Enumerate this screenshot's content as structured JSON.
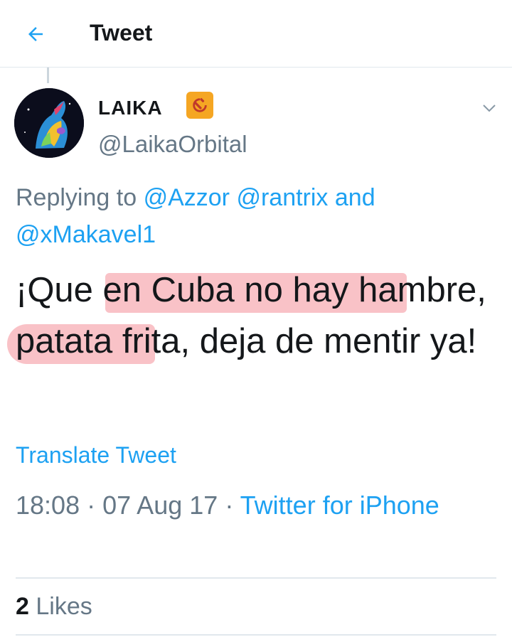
{
  "header": {
    "title": "Tweet"
  },
  "author": {
    "name": "LAIKA",
    "badge_emoji": "☭",
    "handle": "@LaikaOrbital"
  },
  "reply": {
    "prefix": "Replying to",
    "mention_1": "@Azzor",
    "mention_2": "@rantrix",
    "conjunction": "and",
    "mention_3": "@xMakavel1"
  },
  "tweet": {
    "text": "¡Que en Cuba no hay hambre, patata frita, deja de mentir ya!",
    "highlighted_phrase": "en Cuba no hay hambre"
  },
  "translate_label": "Translate Tweet",
  "meta": {
    "time": "18:08",
    "separator": "·",
    "date": "07 Aug 17",
    "source": "Twitter for iPhone"
  },
  "stats": {
    "likes_count": "2",
    "likes_label": "Likes"
  },
  "colors": {
    "link": "#1da1f2",
    "secondary_text": "#657786",
    "highlight": "#f48f99"
  },
  "icons": {
    "back": "arrow-left-icon",
    "more": "chevron-down-icon",
    "badge": "hammer-and-sickle-icon"
  }
}
